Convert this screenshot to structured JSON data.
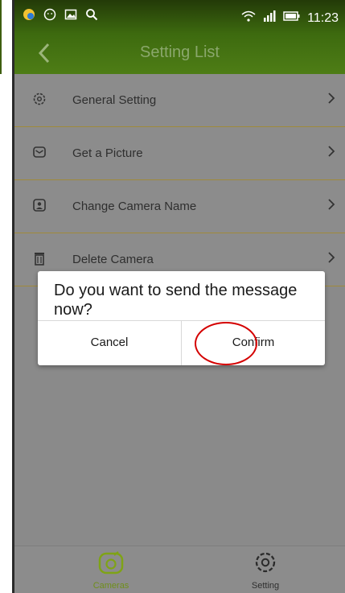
{
  "status_bar": {
    "time": "11:23",
    "left_icons": [
      "app-badge-icon",
      "face-icon",
      "image-icon",
      "search-icon"
    ],
    "right_icons": [
      "wifi-icon",
      "signal-icon",
      "battery-icon"
    ]
  },
  "toolbar": {
    "title": "Setting List",
    "back_icon": "chevron-left-icon"
  },
  "settings": [
    {
      "label": "General Setting",
      "icon": "gear-icon"
    },
    {
      "label": "Get a Picture",
      "icon": "message-icon"
    },
    {
      "label": "Change Camera Name",
      "icon": "person-badge-icon"
    },
    {
      "label": "Delete Camera",
      "icon": "trash-icon"
    }
  ],
  "dialog": {
    "message": "Do you want to send the message now?",
    "cancel_label": "Cancel",
    "confirm_label": "Confirm"
  },
  "bottom_nav": {
    "cameras_label": "Cameras",
    "setting_label": "Setting",
    "active_color": "#7fa316"
  }
}
